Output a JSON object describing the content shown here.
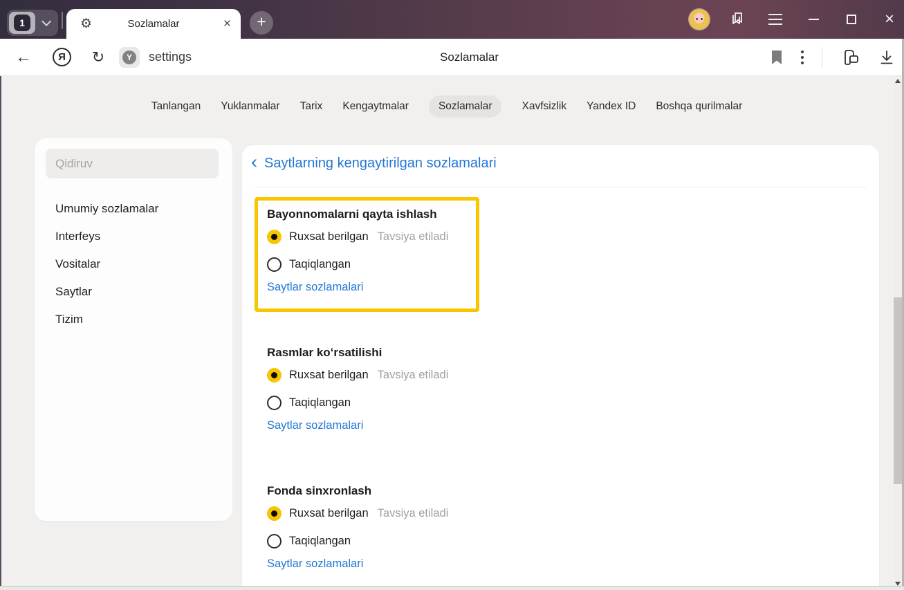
{
  "colors": {
    "accent_yellow": "#f7c600",
    "link_blue": "#2277d4",
    "topbar_left": "#342d3e",
    "topbar_right": "#6b4454",
    "page_bg": "#f1f0ee"
  },
  "icons": {
    "back": "←",
    "refresh": "↻",
    "yandex_logo": "Я",
    "site_badge": "Y",
    "gear": "⚙",
    "tab_close": "×",
    "new_tab": "+",
    "window_close": "×",
    "heading_chevron": "‹"
  },
  "topbar": {
    "tab_count": "1",
    "active_tab_title": "Sozlamalar"
  },
  "omnibox": {
    "url": "settings",
    "page_title": "Sozlamalar"
  },
  "nav": {
    "tabs": [
      "Tanlangan",
      "Yuklanmalar",
      "Tarix",
      "Kengaytmalar",
      "Sozlamalar",
      "Xavfsizlik",
      "Yandex ID",
      "Boshqa qurilmalar"
    ],
    "active": "Sozlamalar"
  },
  "sidebar": {
    "search_placeholder": "Qidiruv",
    "items": [
      "Umumiy sozlamalar",
      "Interfeys",
      "Vositalar",
      "Saytlar",
      "Tizim"
    ]
  },
  "main": {
    "heading": "Saytlarning kengaytirilgan sozlamalari",
    "sections": [
      {
        "title": "Bayonnomalarni qayta ishlash",
        "allowed": "Ruxsat berilgan",
        "recommended": "Tavsiya etiladi",
        "blocked": "Taqiqlangan",
        "link": "Saytlar sozlamalari",
        "selected": "Ruxsat berilgan",
        "highlighted": true
      },
      {
        "title": "Rasmlar koʻrsatilishi",
        "allowed": "Ruxsat berilgan",
        "recommended": "Tavsiya etiladi",
        "blocked": "Taqiqlangan",
        "link": "Saytlar sozlamalari",
        "selected": "Ruxsat berilgan",
        "highlighted": false
      },
      {
        "title": "Fonda sinxronlash",
        "allowed": "Ruxsat berilgan",
        "recommended": "Tavsiya etiladi",
        "blocked": "Taqiqlangan",
        "link": "Saytlar sozlamalari",
        "selected": "Ruxsat berilgan",
        "highlighted": false
      }
    ]
  }
}
